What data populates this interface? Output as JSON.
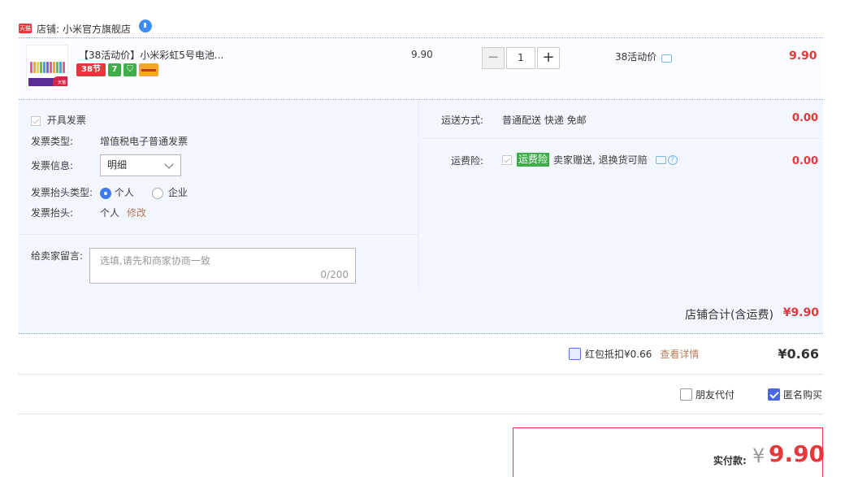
{
  "shop": {
    "tag": "天猫",
    "label": "店铺:",
    "name": "小米官方旗舰店"
  },
  "item": {
    "title": "【38活动价】小米彩虹5号电池...",
    "thumb_text": "天猫",
    "badges": [
      "38节",
      "7"
    ],
    "unit_price": "9.90",
    "qty_minus": "−",
    "qty_value": "1",
    "qty_plus": "+",
    "promo": "38活动价",
    "total": "9.90"
  },
  "invoice": {
    "enable_label": "开具发票",
    "type_label": "发票类型:",
    "type_value": "增值税电子普通发票",
    "info_label": "发票信息:",
    "info_value": "明细",
    "header_type_label": "发票抬头类型:",
    "header_type_personal": "个人",
    "header_type_company": "企业",
    "header_label": "发票抬头:",
    "header_value": "个人",
    "edit_link": "修改"
  },
  "message": {
    "label": "给卖家留言:",
    "placeholder": "选填,请先和商家协商一致",
    "counter": "0/200"
  },
  "shipping": {
    "label": "运送方式:",
    "value": "普通配送 快递 免邮",
    "cost": "0.00"
  },
  "insurance": {
    "label": "运费险:",
    "tag": "运费险",
    "desc": "卖家赠送, 退换货可赔",
    "cost": "0.00"
  },
  "shop_total": {
    "label": "店铺合计(含运费)",
    "value": "¥9.90"
  },
  "red_packet": {
    "label": "红包抵扣¥0.66",
    "detail_link": "查看详情",
    "value": "¥0.66"
  },
  "pay_options": {
    "friend_pay": "朋友代付",
    "anonymous": "匿名购买"
  },
  "final": {
    "label": "实付款:",
    "currency": "¥",
    "value": "9.90"
  },
  "colors": {
    "accent_red": "#e4393c",
    "panel_bg": "#f2f7ff",
    "tag_green": "#3fae49",
    "check_blue": "#4b66e6"
  }
}
